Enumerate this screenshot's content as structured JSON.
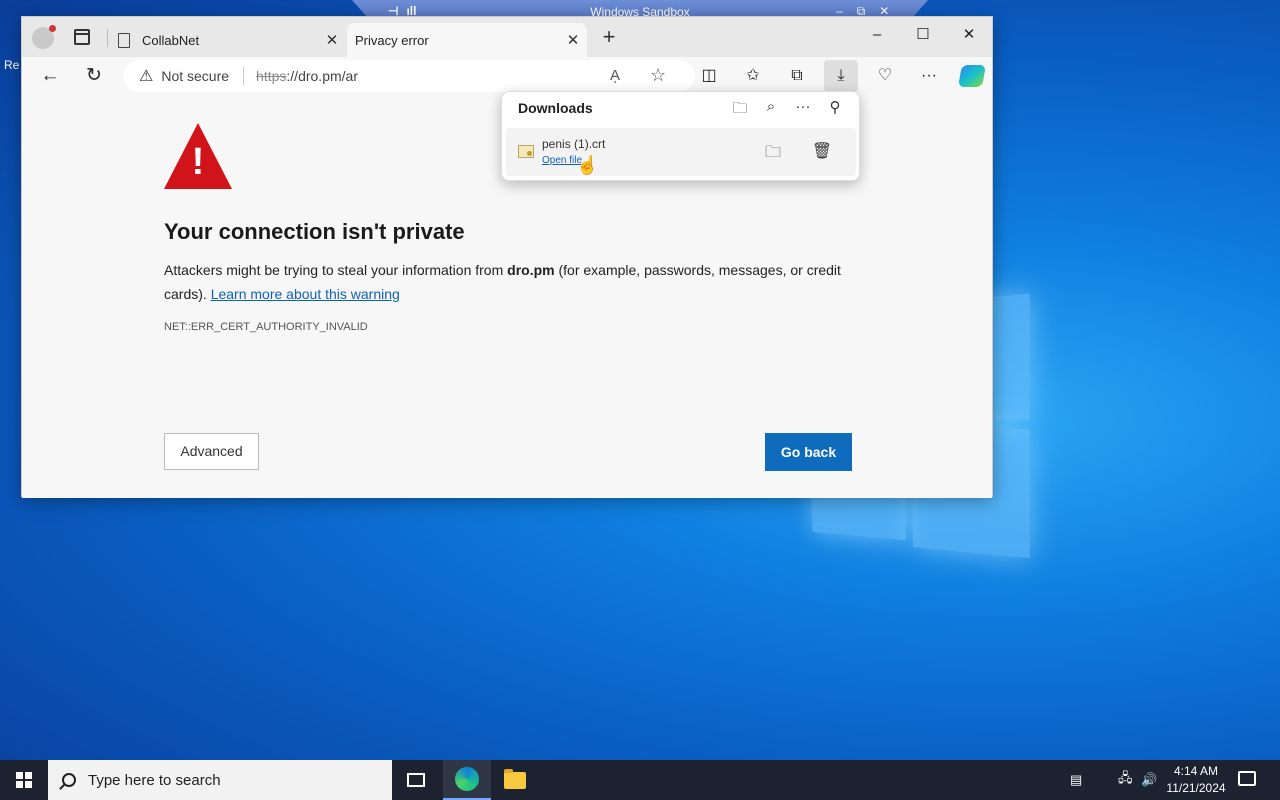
{
  "desktop": {
    "edge_label": "Re"
  },
  "sandbox": {
    "title": "Windows Sandbox",
    "left_icons": [
      "⊣",
      "ıll"
    ],
    "right_icons": [
      "–",
      "⧉",
      "✕"
    ]
  },
  "browser": {
    "tabs": [
      {
        "label": "CollabNet",
        "close": "✕"
      },
      {
        "label": "Privacy error",
        "close": "✕"
      }
    ],
    "new_tab": "+",
    "window_controls": {
      "minimize": "–",
      "maximize": "☐",
      "close": "✕"
    },
    "toolbar": {
      "back": "←",
      "reload": "↻",
      "not_secure": "Not secure",
      "url_protocol": "https",
      "url_rest": "://dro.pm/ar",
      "read_aloud": "Aͅ",
      "favorite": "☆",
      "split": "◫",
      "favorites": "✩",
      "collections": "⧉",
      "downloads": "⤓",
      "health": "♡",
      "more": "···"
    },
    "error_page": {
      "heading": "Your connection isn't private",
      "desc_pre": "Attackers might be trying to steal your information from ",
      "desc_domain": "dro.pm",
      "desc_post": " (for example, passwords, messages, or credit cards). ",
      "learn_more": "Learn more about this warning",
      "error_code": "NET::ERR_CERT_AUTHORITY_INVALID",
      "advanced": "Advanced",
      "go_back": "Go back"
    },
    "downloads": {
      "title": "Downloads",
      "items": [
        {
          "name": "penis (1).crt",
          "action": "Open file"
        }
      ]
    }
  },
  "taskbar": {
    "search_placeholder": "Type here to search",
    "time": "4:14 AM",
    "date": "11/21/2024"
  }
}
